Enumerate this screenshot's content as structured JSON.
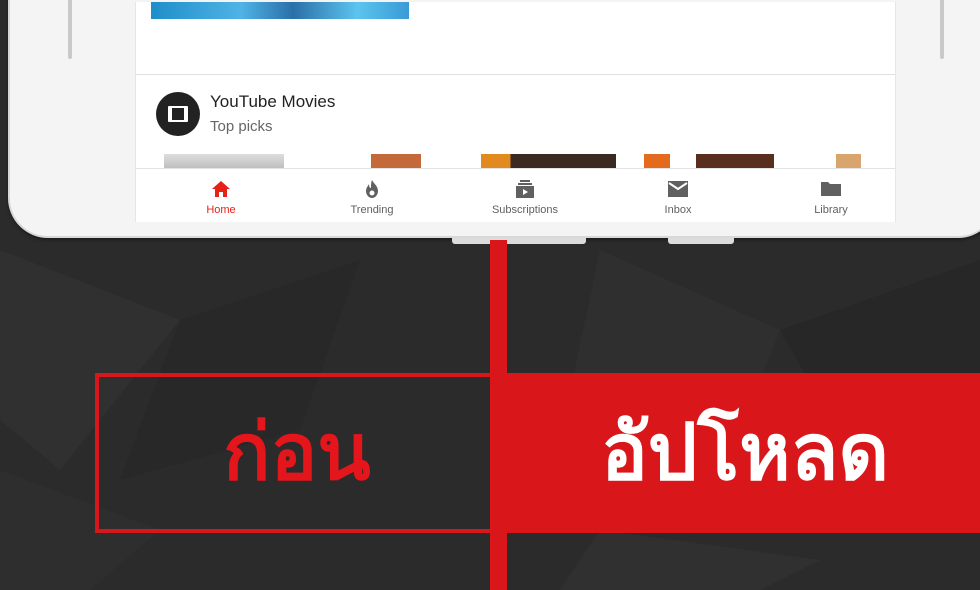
{
  "channel": {
    "title": "YouTube Movies",
    "subtitle": "Top picks"
  },
  "nav": {
    "items": [
      {
        "label": "Home",
        "icon": "home-icon",
        "active": true
      },
      {
        "label": "Trending",
        "icon": "flame-icon",
        "active": false
      },
      {
        "label": "Subscriptions",
        "icon": "subscriptions-icon",
        "active": false
      },
      {
        "label": "Inbox",
        "icon": "mail-icon",
        "active": false
      },
      {
        "label": "Library",
        "icon": "folder-icon",
        "active": false
      }
    ]
  },
  "banner": {
    "before_label": "ก่อน",
    "after_label": "อัปโหลด"
  },
  "colors": {
    "accent_red": "#d9171b",
    "youtube_red": "#e62117",
    "background": "#2b2b2b"
  }
}
